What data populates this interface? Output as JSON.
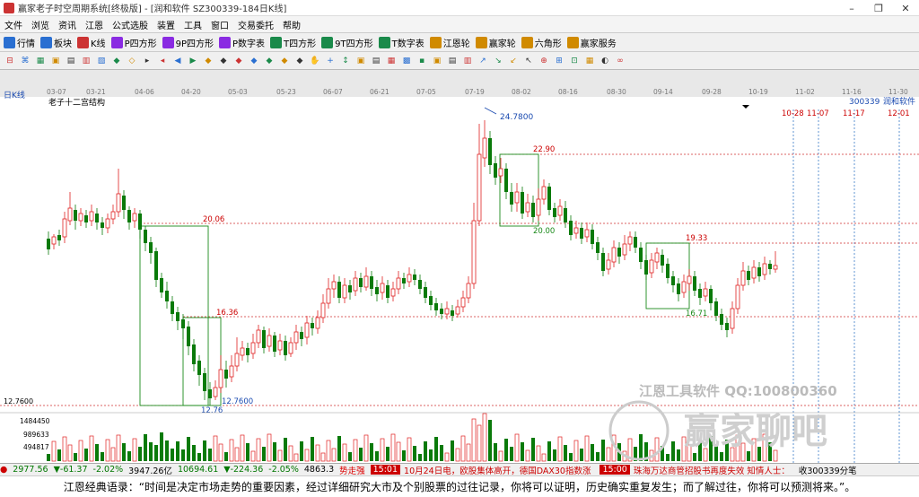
{
  "window": {
    "title": "赢家老子时空周期系统[终极版] - [润和软件 SZ300339-184日K线]",
    "buttons": [
      "–",
      "❐",
      "✕"
    ]
  },
  "menu": {
    "items": [
      "文件",
      "浏览",
      "资讯",
      "江恩",
      "公式选股",
      "装置",
      "工具",
      "窗口",
      "交易委托",
      "帮助"
    ]
  },
  "toolbar1": {
    "items": [
      {
        "label": "行情",
        "color": "#2a6fd1"
      },
      {
        "label": "板块",
        "color": "#2a6fd1"
      },
      {
        "label": "K线",
        "color": "#c33"
      },
      {
        "label": "P四方形",
        "color": "#8a2be2"
      },
      {
        "label": "9P四方形",
        "color": "#8a2be2"
      },
      {
        "label": "P数字表",
        "color": "#8a2be2"
      },
      {
        "label": "T四方形",
        "color": "#1a8a4a"
      },
      {
        "label": "9T四方形",
        "color": "#1a8a4a"
      },
      {
        "label": "T数字表",
        "color": "#1a8a4a"
      },
      {
        "label": "江恩轮",
        "color": "#d08a00"
      },
      {
        "label": "赢家轮",
        "color": "#d08a00"
      },
      {
        "label": "六角形",
        "color": "#d08a00"
      },
      {
        "label": "赢家服务",
        "color": "#d08a00"
      }
    ]
  },
  "toolbar2": {
    "icons": [
      "⊟",
      "⌘",
      "▦",
      "▣",
      "▤",
      "▥",
      "▧",
      "◆",
      "◇",
      "▸",
      "◂",
      "◀",
      "▶",
      "◆",
      "◆",
      "◆",
      "◆",
      "◆",
      "◆",
      "◆",
      "✋",
      "+",
      "↕",
      "▣",
      "▤",
      "▦",
      "▩",
      "▪",
      "▣",
      "▤",
      "▥",
      "↗",
      "↘",
      "↙",
      "↖",
      "⊕",
      "⊞",
      "⊡",
      "▦",
      "◐",
      "∞"
    ]
  },
  "chart": {
    "period_label": "日K线",
    "indicator_name": "老子十二宫结构",
    "code": "300339",
    "company": "润和软件",
    "dates_top": [
      "03-07",
      "03-21",
      "04-06",
      "04-20",
      "05-03",
      "05-23",
      "06-07",
      "06-21",
      "07-05",
      "07-19",
      "08-02",
      "08-16",
      "08-30",
      "09-14",
      "09-28",
      "10-19",
      "11-02",
      "11-16",
      "11-30"
    ],
    "forecast_dates": [
      "10-28",
      "11-07",
      "11-17",
      "12-01"
    ],
    "price_labels": [
      {
        "text": "24.7800"
      },
      {
        "text": "22.90"
      },
      {
        "text": "20.06"
      },
      {
        "text": "20.00"
      },
      {
        "text": "19.33"
      },
      {
        "text": "16.36"
      },
      {
        "text": "16.71"
      },
      {
        "text": "12.7600"
      },
      {
        "text": "12.7600"
      },
      {
        "text": "12.76"
      }
    ],
    "y_axis_left": "12.7600",
    "volume_axis": [
      "1484450",
      "989633",
      "494817"
    ],
    "watermark_qq": "江恩工具软件  QQ:100800360",
    "watermark_brand": "赢家聊吧",
    "colors": {
      "up": "#e02020",
      "down": "#0a7a0a",
      "box": "#1a8a1a",
      "level": "#d03030",
      "future": "#3a7ac8"
    }
  },
  "statusbar": {
    "idx1_val": "2977.56",
    "idx1_chg": "▼-61.37",
    "idx1_pct": "-2.02%",
    "idx1_amt": "3947.26亿",
    "idx2_val": "10694.61",
    "idx2_chg": "▼-224.36",
    "idx2_pct": "-2.05%",
    "idx2_amt": "4863.3",
    "strength": "势走强",
    "news1_time": "15:01",
    "news1": "10月24日电，欧股集体高开，德国DAX30指数涨",
    "news2_time": "15:00",
    "news2": "珠海万达商管招股书再度失效 知情人士：",
    "right": "收300339分笔"
  },
  "quote": {
    "text": "江恩经典语录：“时间是决定市场走势的重要因素，经过详细研究大市及个别股票的过往记录，你将可以证明，历史确实重复发生；而了解过往，你将可以预测将来。”。"
  }
}
